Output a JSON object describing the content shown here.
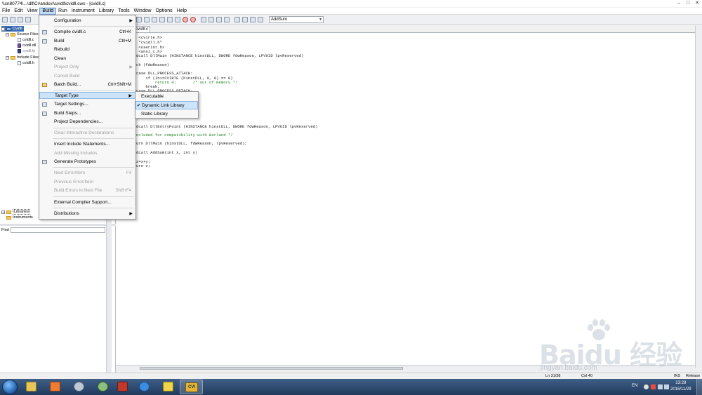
{
  "window": {
    "title": "\\\\cn80774\\...\\dll\\C#andcvi\\cvidll\\cvidll.cws - [cvidll.c]",
    "controls": [
      "–",
      "□",
      "✕"
    ]
  },
  "menubar": {
    "items": [
      "File",
      "Edit",
      "View",
      "Build",
      "Run",
      "Instrument",
      "Library",
      "Tools",
      "Window",
      "Options",
      "Help"
    ],
    "active_item": "Build"
  },
  "toolbar": {
    "function_select": "AddSum"
  },
  "tree": {
    "root": "Cvidll",
    "source_folder": "Source Files",
    "source_files": [
      "cvidll.c",
      "cvidll.dll",
      "cvidll.fp"
    ],
    "include_folder": "Include Files",
    "include_files": [
      "cvidll.h"
    ],
    "find_label": "Find",
    "libraries": "Libraries",
    "instruments": "Instruments"
  },
  "editor": {
    "tab": "cvidll.c",
    "lines": [
      {
        "text": " <cvirte.h>",
        "kind": "code"
      },
      {
        "text": " \"cvidll.h\"",
        "kind": "code"
      },
      {
        "text": " <userint.h>",
        "kind": "code"
      },
      {
        "text": " <ansi_c.h>",
        "kind": "code"
      },
      {
        "text": "dcall DllMain (HINSTANCE hinstDLL, DWORD fdwReason, LPVOID lpvReserved)",
        "kind": "code"
      },
      {
        "text": "",
        "kind": "code"
      },
      {
        "text": "ch (fdwReason)",
        "kind": "code"
      },
      {
        "text": "",
        "kind": "code"
      },
      {
        "text": "case DLL_PROCESS_ATTACH:",
        "kind": "code"
      },
      {
        "text": "    if (InitCVIRTE (hinstDLL, 0, 0) == 0)",
        "kind": "code"
      },
      {
        "text": "        return 0;       /* out of memory */",
        "kind": "comment"
      },
      {
        "text": "    break;",
        "kind": "code"
      },
      {
        "text": "case DLL_PROCESS_DETACH:",
        "kind": "code"
      },
      {
        "text": "dcall DllEntryPoint (HINSTANCE hinstDLL, DWORD fdwReason, LPVOID lpvReserved)",
        "kind": "code"
      },
      {
        "text": "ncluded for compatibility with Borland */",
        "kind": "comment"
      },
      {
        "text": "urn DllMain (hinstDLL, fdwReason, lpvReserved);",
        "kind": "code"
      },
      {
        "text": "dcall AddSum(int x, int y)",
        "kind": "code"
      },
      {
        "text": "z=x+y;",
        "kind": "code"
      },
      {
        "text": "urn z;",
        "kind": "code"
      }
    ]
  },
  "build_menu": {
    "items": [
      {
        "label": "Configuration",
        "shortcut": "",
        "submenu": true,
        "disabled": false
      },
      {
        "label": "Compile cvidll.c",
        "shortcut": "Ctrl+K",
        "submenu": false,
        "disabled": false
      },
      {
        "label": "Build",
        "shortcut": "Ctrl+M",
        "submenu": false,
        "disabled": false
      },
      {
        "label": "Rebuild",
        "shortcut": "",
        "submenu": false,
        "disabled": false
      },
      {
        "label": "Clean",
        "shortcut": "",
        "submenu": false,
        "disabled": false
      },
      {
        "label": "Project Only",
        "shortcut": "",
        "submenu": true,
        "disabled": true
      },
      {
        "label": "Cancel Build",
        "shortcut": "",
        "submenu": false,
        "disabled": true
      },
      {
        "label": "Batch Build...",
        "shortcut": "Ctrl+Shift+M",
        "submenu": false,
        "disabled": false
      },
      {
        "label": "Target Type",
        "shortcut": "",
        "submenu": true,
        "disabled": false
      },
      {
        "label": "Target Settings...",
        "shortcut": "",
        "submenu": false,
        "disabled": false
      },
      {
        "label": "Build Steps...",
        "shortcut": "",
        "submenu": false,
        "disabled": false
      },
      {
        "label": "Project Dependencies...",
        "shortcut": "",
        "submenu": false,
        "disabled": false
      },
      {
        "label": "Clear Interactive Declarations",
        "shortcut": "",
        "submenu": false,
        "disabled": true
      },
      {
        "label": "Insert Include Statements...",
        "shortcut": "",
        "submenu": false,
        "disabled": false
      },
      {
        "label": "Add Missing Includes",
        "shortcut": "",
        "submenu": false,
        "disabled": true
      },
      {
        "label": "Generate Prototypes",
        "shortcut": "",
        "submenu": false,
        "disabled": false
      },
      {
        "label": "Next Error/Item",
        "shortcut": "F4",
        "submenu": false,
        "disabled": true
      },
      {
        "label": "Previous Error/Item",
        "shortcut": "",
        "submenu": false,
        "disabled": true
      },
      {
        "label": "Build Errors in Next File",
        "shortcut": "Shift+F4",
        "submenu": false,
        "disabled": true
      },
      {
        "label": "External Compiler Support...",
        "shortcut": "",
        "submenu": false,
        "disabled": false
      },
      {
        "label": "Distributions",
        "shortcut": "",
        "submenu": true,
        "disabled": false
      }
    ],
    "highlighted": "Target Type"
  },
  "target_type_submenu": {
    "items": [
      "Executable",
      "Dynamic Link Library",
      "Static Library"
    ],
    "checked": "Dynamic Link Library"
  },
  "statusbar": {
    "line": "Ln 31/38",
    "col": "Col 40",
    "ins": "INS",
    "config": "Release"
  },
  "taskbar": {
    "lang": "EN",
    "time": "13:28",
    "date": "2016/11/29",
    "active_app": "CVI"
  },
  "watermark": {
    "text": "Baidu 经验",
    "url": "jingyan.baidu.com"
  }
}
